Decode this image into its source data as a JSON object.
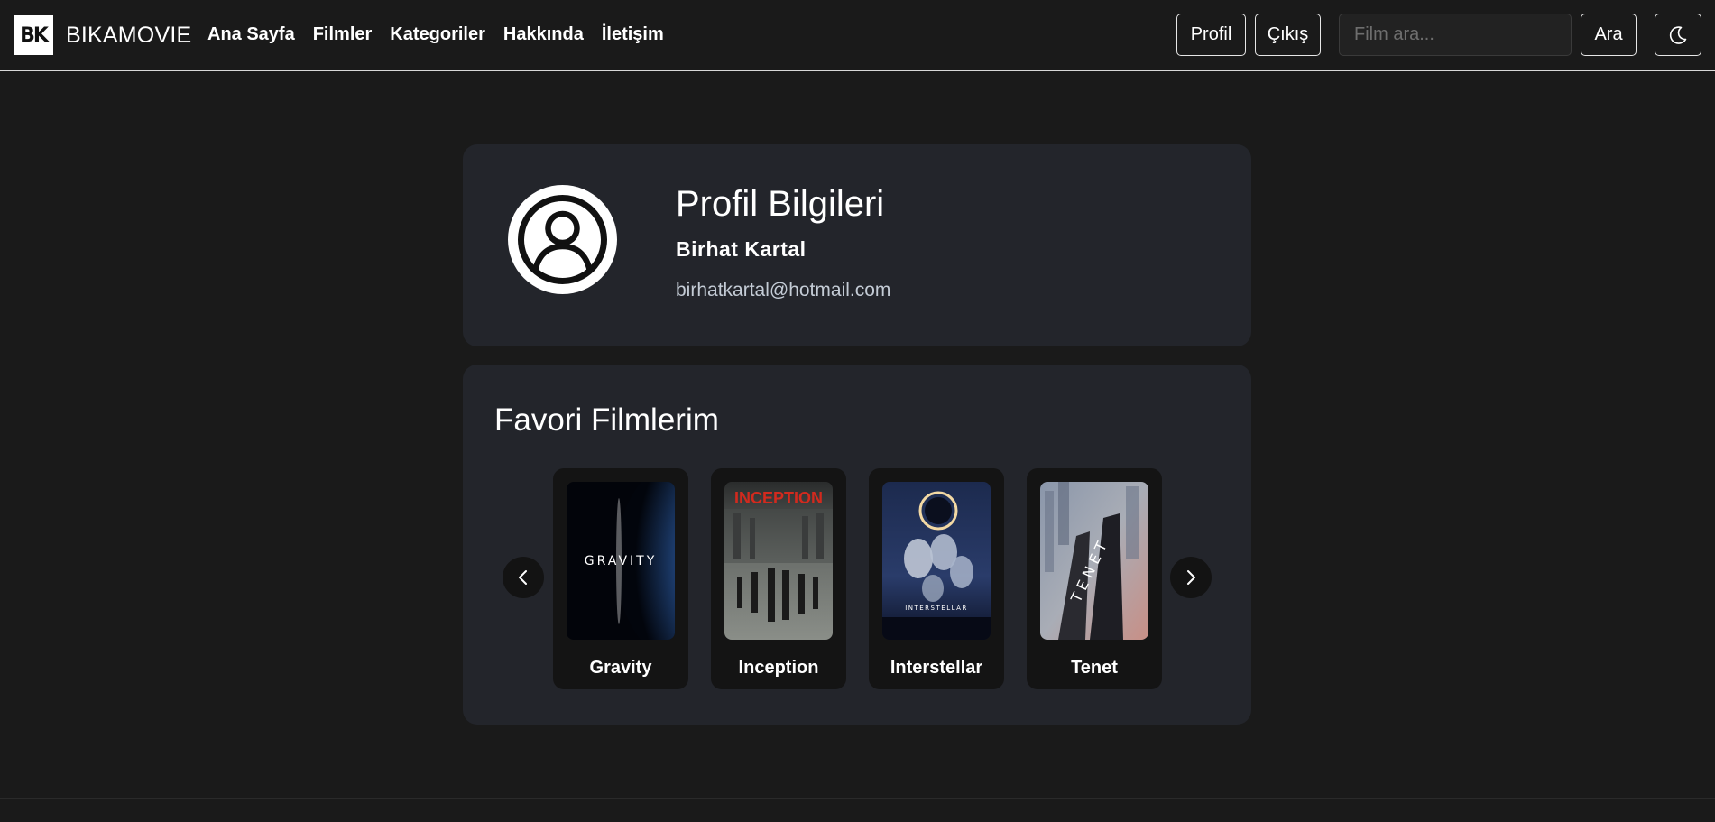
{
  "brand": {
    "logo_text": "BK",
    "name": "BIKAMOVIE"
  },
  "nav": {
    "links": [
      "Ana Sayfa",
      "Filmler",
      "Kategoriler",
      "Hakkında",
      "İletişim"
    ],
    "profile_label": "Profil",
    "logout_label": "Çıkış",
    "search_placeholder": "Film ara...",
    "search_label": "Ara",
    "theme_icon": "moon-icon"
  },
  "profile": {
    "title": "Profil Bilgileri",
    "name": "Birhat Kartal",
    "email": "birhatkartal@hotmail.com",
    "avatar_icon": "user-circle-icon"
  },
  "favorites": {
    "title": "Favori Filmlerim",
    "movies": [
      {
        "title": "Gravity",
        "poster_text": "GRAVITY"
      },
      {
        "title": "Inception",
        "poster_text": "INCEPTION"
      },
      {
        "title": "Interstellar",
        "poster_text": "INTERSTELLAR"
      },
      {
        "title": "Tenet",
        "poster_text": "TENET"
      }
    ],
    "prev_icon": "chevron-left-icon",
    "next_icon": "chevron-right-icon"
  },
  "colors": {
    "background": "#1a1a1a",
    "card": "#23252b",
    "email_text": "#c4ccd6",
    "inception_red": "#d22a1e"
  }
}
